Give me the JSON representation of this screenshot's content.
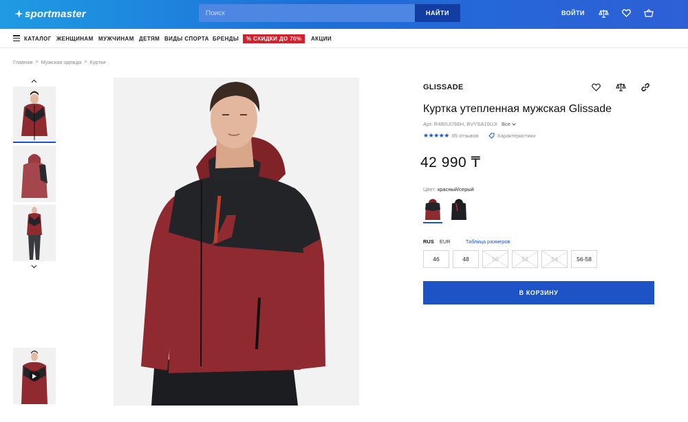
{
  "header": {
    "logo_text": "sportmaster",
    "search_placeholder": "Поиск",
    "search_button": "НАЙТИ",
    "login": "ВОЙТИ",
    "icons": [
      "compare-icon",
      "heart-icon",
      "basket-icon"
    ]
  },
  "nav": {
    "items": [
      "КАТАЛОГ",
      "ЖЕНЩИНАМ",
      "МУЖЧИНАМ",
      "ДЕТЯМ",
      "ВИДЫ СПОРТА",
      "БРЕНДЫ"
    ],
    "sale": "% СКИДКИ ДО 70%",
    "promo": "АКЦИИ"
  },
  "breadcrumb": [
    "Главная",
    "Мужская одежда",
    "Куртки"
  ],
  "product": {
    "brand": "GLISSADE",
    "title": "Куртка утепленная мужская Glissade",
    "sku": "Арт. R480UI766H, BVYSA10UJI",
    "sku_all": "Все",
    "rating_stars": "★★★★★",
    "reviews": "85 отзывов",
    "characteristics": "Характеристики",
    "price": "42 990 ₸",
    "color_label": "Цвет:",
    "color_value": "красный/серый",
    "size_systems": [
      "RUS",
      "EUR"
    ],
    "size_table": "Таблица размеров",
    "sizes": [
      {
        "label": "46",
        "available": true
      },
      {
        "label": "48",
        "available": true
      },
      {
        "label": "50",
        "available": false
      },
      {
        "label": "52",
        "available": false
      },
      {
        "label": "54",
        "available": false
      },
      {
        "label": "56-58",
        "available": true
      }
    ],
    "cart_button": "В КОРЗИНУ"
  },
  "colors": {
    "brand_blue": "#1d53c5",
    "sale_red": "#d4202c",
    "jacket_red": "#8e2a30",
    "jacket_black": "#222428"
  }
}
